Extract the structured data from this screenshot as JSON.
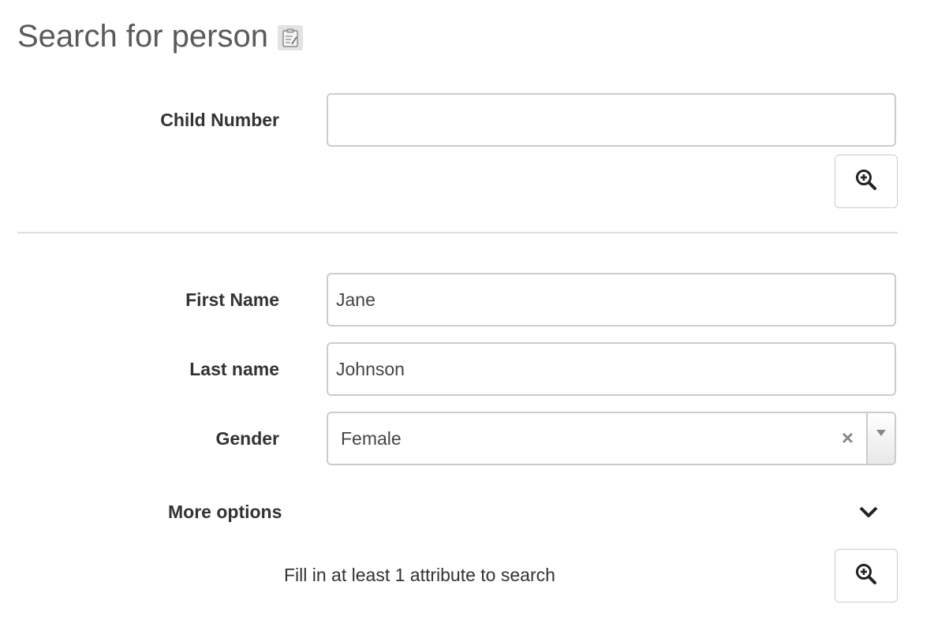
{
  "page": {
    "title": "Search for person",
    "title_icon": "clipboard-edit-icon"
  },
  "unique_search": {
    "child_number_label": "Child Number",
    "child_number_value": "",
    "search_icon": "zoom-in-icon"
  },
  "attribute_search": {
    "first_name_label": "First Name",
    "first_name_value": "Jane",
    "last_name_label": "Last name",
    "last_name_value": "Johnson",
    "gender_label": "Gender",
    "gender_value": "Female",
    "gender_clear": "×",
    "more_options_label": "More options",
    "hint_text": "Fill in at least 1 attribute to search",
    "search_icon": "zoom-in-icon"
  },
  "colors": {
    "title": "#5a5a5a",
    "border": "#cccccc",
    "divider": "#dddddd"
  }
}
